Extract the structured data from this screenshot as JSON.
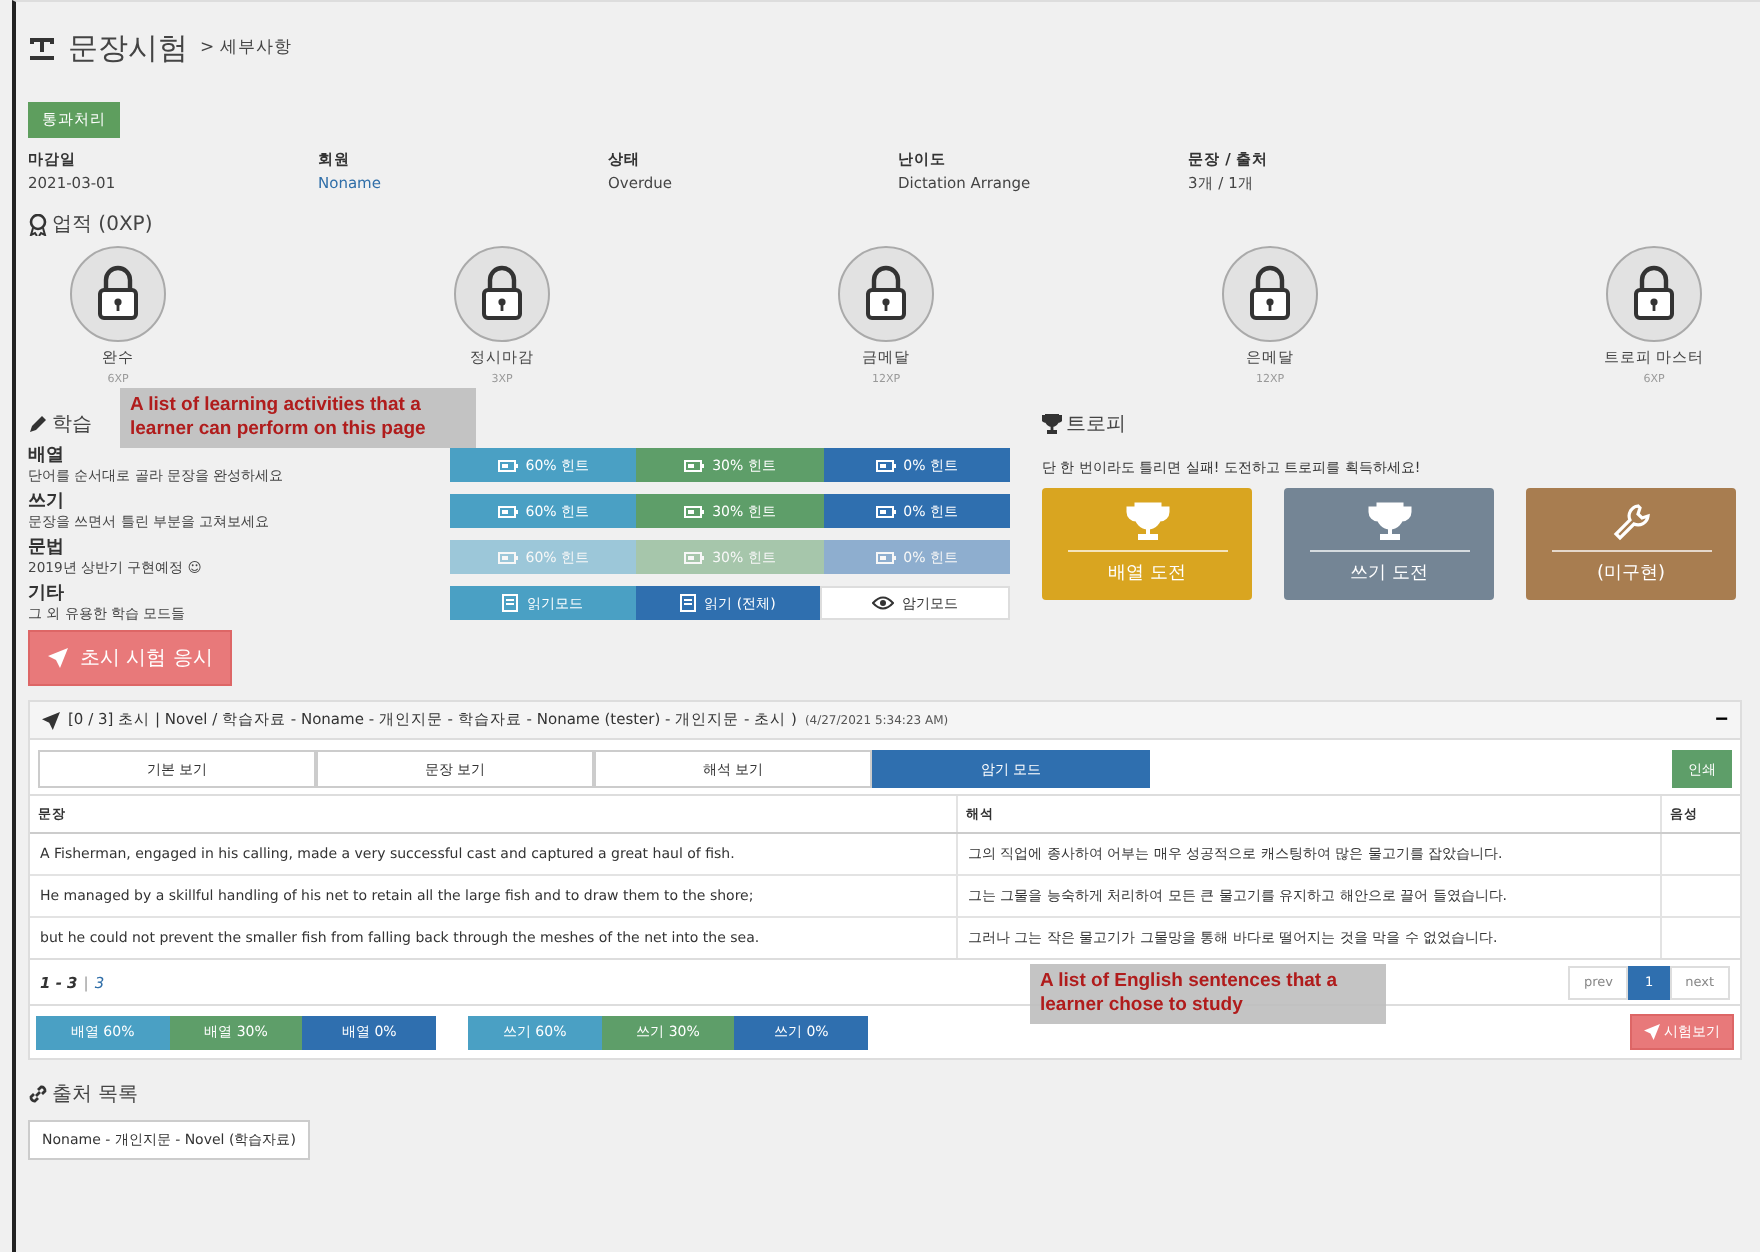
{
  "header": {
    "title": "문장시험",
    "breadcrumb": "> 세부사항"
  },
  "pass_button": "통과처리",
  "info": [
    {
      "label": "마감일",
      "value": "2021-03-01",
      "kind": "text"
    },
    {
      "label": "회원",
      "value": "Noname",
      "kind": "link"
    },
    {
      "label": "상태",
      "value": "Overdue",
      "kind": "text"
    },
    {
      "label": "난이도",
      "value": "Dictation Arrange",
      "kind": "text"
    },
    {
      "label": "문장 / 출처",
      "value": "3개 / 1개",
      "kind": "text"
    }
  ],
  "achievements": {
    "title": "업적 (0XP)",
    "items": [
      {
        "name": "완수",
        "xp": "6XP"
      },
      {
        "name": "정시마감",
        "xp": "3XP"
      },
      {
        "name": "금메달",
        "xp": "12XP"
      },
      {
        "name": "은메달",
        "xp": "12XP"
      },
      {
        "name": "트로피 마스터",
        "xp": "6XP"
      }
    ]
  },
  "study": {
    "title": "학습",
    "rows": [
      {
        "name": "배열",
        "description": "단어를 순서대로 골라 문장을 완성하세요",
        "disabled": false,
        "buttons": [
          {
            "label": "60% 힌트",
            "kind": "info"
          },
          {
            "label": "30% 힌트",
            "kind": "success"
          },
          {
            "label": "0% 힌트",
            "kind": "primary"
          }
        ]
      },
      {
        "name": "쓰기",
        "description": "문장을 쓰면서 틀린 부분을 고쳐보세요",
        "disabled": false,
        "buttons": [
          {
            "label": "60% 힌트",
            "kind": "info"
          },
          {
            "label": "30% 힌트",
            "kind": "success"
          },
          {
            "label": "0% 힌트",
            "kind": "primary"
          }
        ]
      },
      {
        "name": "문법",
        "description": "2019년 상반기 구현예정 ☺",
        "disabled": true,
        "buttons": [
          {
            "label": "60% 힌트",
            "kind": "info"
          },
          {
            "label": "30% 힌트",
            "kind": "success"
          },
          {
            "label": "0% 힌트",
            "kind": "primary"
          }
        ]
      },
      {
        "name": "기타",
        "description": "그 외 유용한 학습 모드들",
        "disabled": false,
        "buttons": [
          {
            "label": "읽기모드",
            "kind": "info"
          },
          {
            "label": "읽기 (전체)",
            "kind": "primary"
          },
          {
            "label": "암기모드",
            "kind": "default"
          }
        ]
      }
    ]
  },
  "test_button": "초시 시험 응시",
  "trophy": {
    "title": "트로피",
    "subtitle": "단 한 번이라도 틀리면 실패! 도전하고 트로피를 획득하세요!",
    "cards": [
      {
        "label": "배열 도전",
        "color": "#d9a520",
        "kind": "trophy"
      },
      {
        "label": "쓰기 도전",
        "color": "#748595",
        "kind": "trophy"
      },
      {
        "label": "(미구현)",
        "color": "#a87d50",
        "kind": "wrench"
      }
    ]
  },
  "panel": {
    "title": "[0 / 3] 초시 | Novel / 학습자료 - Noname - 개인지문 - 학습자료 - Noname (tester) - 개인지문 - 초시 )",
    "timestamp": "(4/27/2021 5:34:23 AM)",
    "collapse": "−",
    "tabs": [
      {
        "label": "기본 보기",
        "selected": false
      },
      {
        "label": "문장 보기",
        "selected": false
      },
      {
        "label": "해석 보기",
        "selected": false
      },
      {
        "label": "암기 모드",
        "selected": true
      }
    ],
    "print_button": "인쇄",
    "table": {
      "columns": [
        "문장",
        "해석",
        "음성"
      ],
      "rows": [
        [
          "A Fisherman, engaged in his calling, made a very successful cast and captured a great haul of fish.",
          "그의 직업에 종사하여 어부는 매우 성공적으로 캐스팅하여 많은 물고기를 잡았습니다."
        ],
        [
          "He managed by a skillful handling of his net to retain all the large fish and to draw them to the shore;",
          "그는 그물을 능숙하게 처리하여 모든 큰 물고기를 유지하고 해안으로 끌어 들였습니다."
        ],
        [
          "but he could not prevent the smaller fish from falling back through the meshes of the net into the sea.",
          "그러나 그는 작은 물고기가 그물망을 통해 바다로 떨어지는 것을 막을 수 없었습니다."
        ]
      ]
    },
    "range": "1 - 3",
    "separator": "|",
    "total": "3",
    "pagination": [
      {
        "label": "prev",
        "selected": false
      },
      {
        "label": "1",
        "selected": true
      },
      {
        "label": "next",
        "selected": false
      }
    ],
    "bottom_groups": [
      [
        {
          "label": "배열 60%",
          "kind": "info"
        },
        {
          "label": "배열 30%",
          "kind": "success"
        },
        {
          "label": "배열 0%",
          "kind": "primary"
        }
      ],
      [
        {
          "label": "쓰기 60%",
          "kind": "info"
        },
        {
          "label": "쓰기 30%",
          "kind": "success"
        },
        {
          "label": "쓰기 0%",
          "kind": "primary"
        }
      ]
    ],
    "exam_button": "시험보기"
  },
  "sources": {
    "title": "출처 목록",
    "items": [
      "Noname - 개인지문 - Novel (학습자료)"
    ]
  },
  "annotations": [
    "A list of learning activities that a learner can perform on this page",
    "A list of English sentences that a learner chose to study"
  ]
}
